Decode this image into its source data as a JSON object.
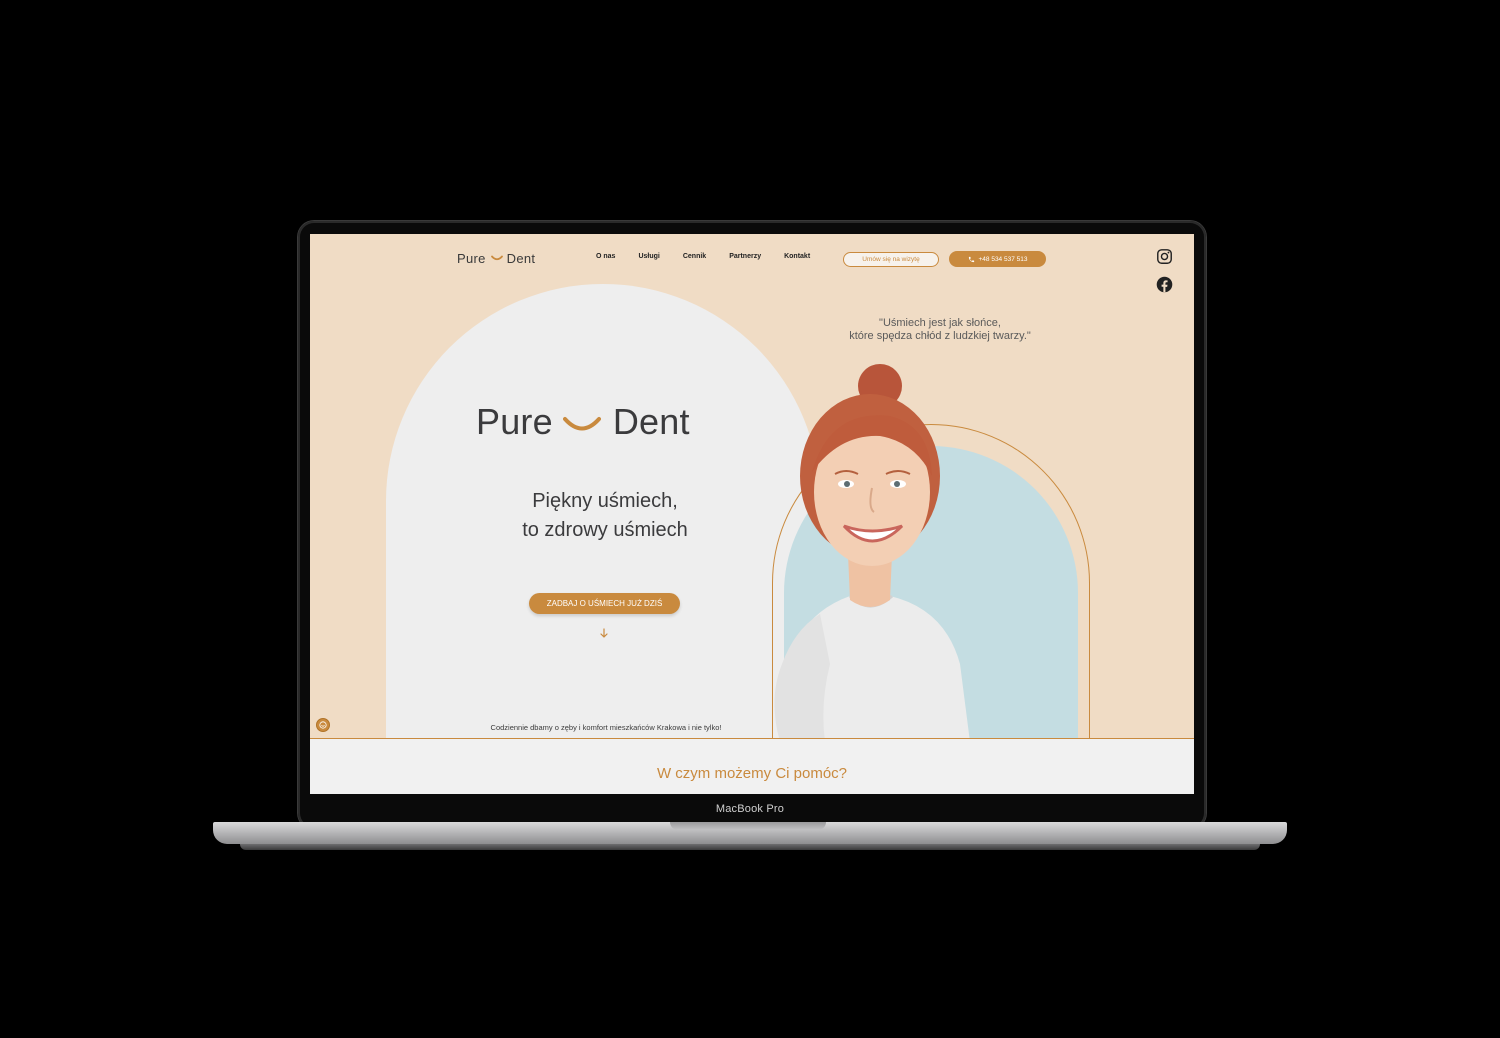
{
  "device": {
    "label": "MacBook Pro"
  },
  "nav": {
    "logo": {
      "left": "Pure",
      "right": "Dent"
    },
    "menu": [
      {
        "label": "O nas"
      },
      {
        "label": "Usługi"
      },
      {
        "label": "Cennik"
      },
      {
        "label": "Partnerzy"
      },
      {
        "label": "Kontakt"
      }
    ],
    "appointment_label": "Umów się na wizytę",
    "phone_label": "+48 534 537 513"
  },
  "social": {
    "instagram": "instagram-icon",
    "facebook": "facebook-icon"
  },
  "quote": {
    "line1": "\"Uśmiech jest jak słońce,",
    "line2": "które spędza chłód z ludzkiej twarzy.\""
  },
  "hero": {
    "logo": {
      "left": "Pure",
      "right": "Dent"
    },
    "tagline_line1": "Piękny uśmiech,",
    "tagline_line2": "to zdrowy uśmiech",
    "cta_label": "ZADBAJ O UŚMIECH JUŻ DZIŚ",
    "caption": "Codziennie dbamy o zęby i komfort mieszkańców Krakowa i nie tylko!"
  },
  "services": {
    "title": "W czym możemy Ci pomóc?"
  },
  "colors": {
    "accent": "#c98a3e",
    "page_bg": "#f0dcc5",
    "arch_bg": "#eeeeee",
    "photo_bg": "#c4dde2",
    "text_dark": "#3b3b3d"
  }
}
